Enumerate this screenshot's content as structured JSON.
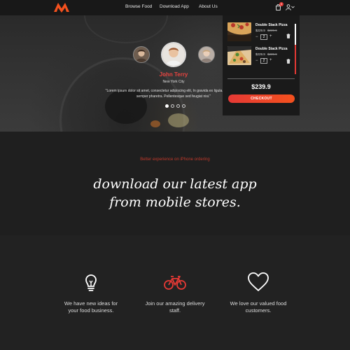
{
  "header": {
    "nav": [
      "Browse Food",
      "Download App",
      "About Us"
    ],
    "cart_count": "0"
  },
  "testimonial": {
    "name": "John Terry",
    "city": "New York City",
    "quote": "\"Lorem ipsum dolor sit amet, consectetur adipiscing elit, In gravida ex ligula. Cras varius semper pharetra. Pellentesque sed feugiat nisi.\"",
    "active_slide": 1,
    "slide_count": 4
  },
  "cart": {
    "items": [
      {
        "name": "Double Stack Pizza",
        "price": "$229.9",
        "old_price": "$239.9",
        "qty": "2"
      },
      {
        "name": "Double Stack Pizza",
        "price": "$229.9",
        "old_price": "$239.9",
        "qty": "2"
      }
    ],
    "total": "$239.9",
    "checkout_label": "CHECKOUT"
  },
  "app": {
    "kicker": "Better experience on iPhone ordering",
    "title_line1": "download our latest app",
    "title_line2": "from mobile stores."
  },
  "features": [
    {
      "icon": "lightbulb-icon",
      "text": "We have new ideas for your food business."
    },
    {
      "icon": "bicycle-icon",
      "text": "Join our amazing delivery staff."
    },
    {
      "icon": "heart-icon",
      "text": "We love our valued food customers."
    }
  ],
  "colors": {
    "accent": "#e53935",
    "background": "#1c1c1c"
  }
}
